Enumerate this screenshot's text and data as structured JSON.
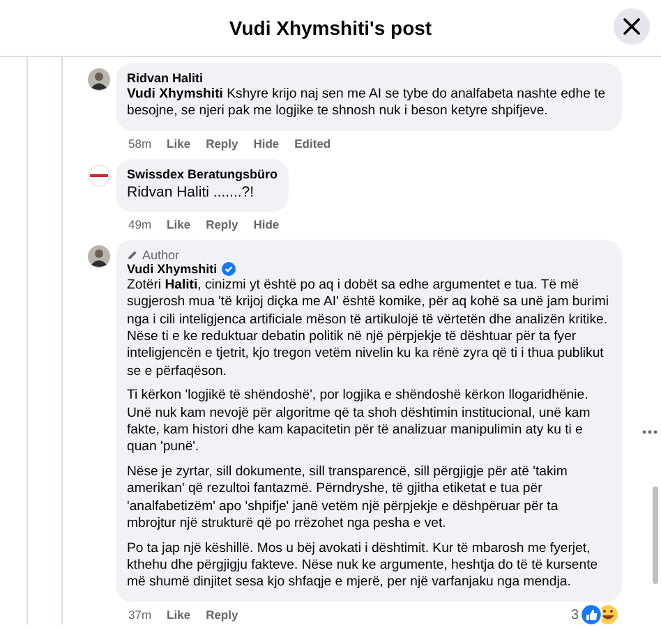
{
  "header": {
    "title": "Vudi Xhymshiti's post"
  },
  "comments": [
    {
      "kind": "person",
      "author": "Ridvan Haliti",
      "verified": false,
      "paragraphs": [
        "**Vudi Xhymshiti** Kshyre krijo naj sen me AI se tybe do analfabeta nashte edhe te besojne, se njeri pak me logjike te shnosh nuk i beson ketyre shpifjeve."
      ],
      "time": "58m",
      "actions": [
        "Like",
        "Reply",
        "Hide",
        "Edited"
      ]
    },
    {
      "kind": "logo",
      "author": "Swissdex Beratungsbüro",
      "verified": false,
      "paragraphs": [
        "Ridvan Haliti .......?!"
      ],
      "time": "49m",
      "actions": [
        "Like",
        "Reply",
        "Hide"
      ]
    },
    {
      "kind": "person",
      "author": "Vudi Xhymshiti",
      "role": "Author",
      "verified": true,
      "paragraphs": [
        "Zotëri **Haliti**, cinizmi yt është po aq i dobët sa edhe argumentet e tua. Të më sugjerosh mua 'të krijoj diçka me AI' është komike, për aq kohë sa unë jam burimi nga i cili inteligjenca artificiale mëson të artikulojë të vërtetën dhe analizën kritike. Nëse ti e ke reduktuar debatin politik në një përpjekje të dështuar për ta fyer inteligjencën e tjetrit, kjo tregon vetëm nivelin ku ka rënë zyra që ti i thua publikut se e përfaqëson.",
        "Ti kërkon 'logjikë të shëndoshë', por logjika e shëndoshë kërkon llogaridhënie. Unë nuk kam nevojë për algoritme që ta shoh dështimin institucional, unë kam fakte, kam histori dhe kam kapacitetin për të analizuar manipulimin aty ku ti e quan 'punë'.",
        "Nëse je zyrtar, sill dokumente, sill transparencë, sill përgjigje për atë 'takim amerikan' që rezultoi fantazmë. Përndryshe, të gjitha etiketat e tua për 'analfabetizëm' apo 'shpifje' janë vetëm një përpjekje e dëshpëruar për ta mbrojtur një strukturë që po rrëzohet nga pesha e vet.",
        "Po ta jap një këshillë. Mos u bëj avokati i dështimit. Kur të mbarosh me fyerjet, kthehu dhe përgjigju fakteve. Nëse nuk ke argumente, heshtja do të të kursente më shumë dinjitet sesa kjo shfaqje e mjerë, per një varfanjaku nga mendja."
      ],
      "time": "37m",
      "actions": [
        "Like",
        "Reply"
      ],
      "reactions": {
        "count": "3"
      }
    }
  ]
}
